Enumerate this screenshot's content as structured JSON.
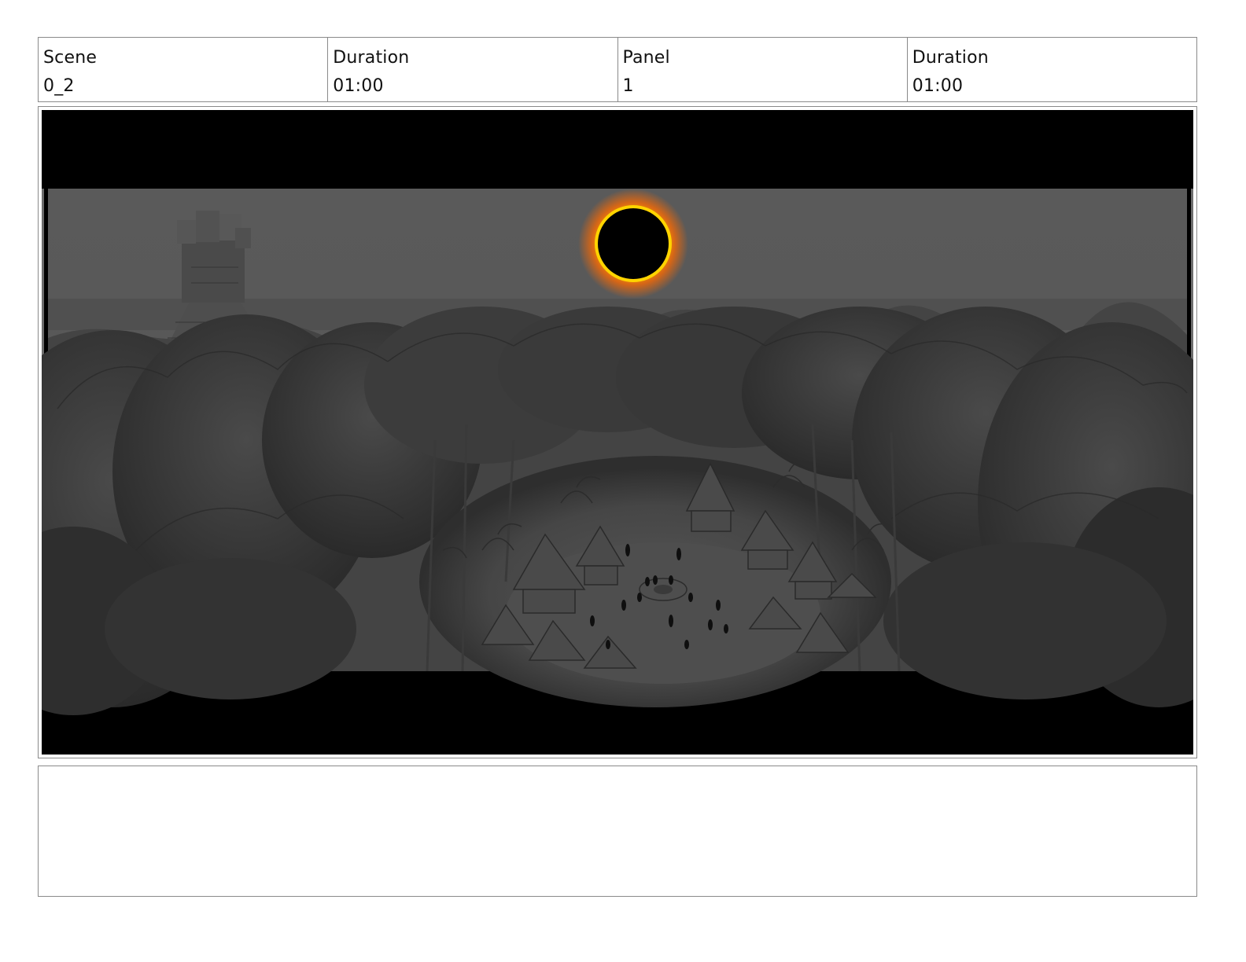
{
  "header": {
    "scene_label": "Scene",
    "scene_value": "0_2",
    "scene_duration_label": "Duration",
    "scene_duration_value": "01:00",
    "panel_label": "Panel",
    "panel_value": "1",
    "panel_duration_label": "Duration",
    "panel_duration_value": "01:00"
  },
  "panel": {
    "colors": {
      "letterbox": "#000000",
      "sky": "#5a5a5a",
      "eclipse_corona": "#ff8a00",
      "eclipse_ring": "#ffd400"
    }
  },
  "notes": {
    "text": ""
  }
}
